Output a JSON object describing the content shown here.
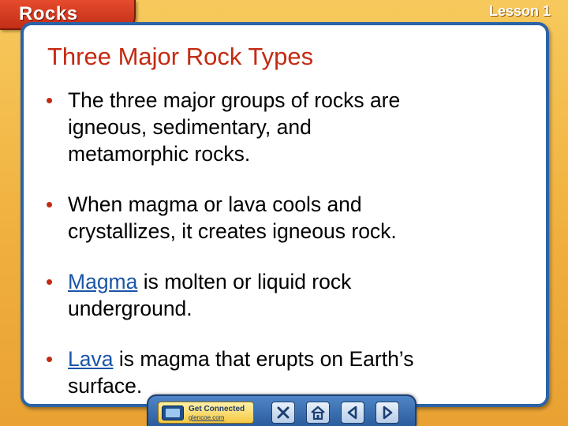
{
  "header": {
    "section_label": "Rocks",
    "lesson_label": "Lesson 1"
  },
  "slide": {
    "title": "Three Major Rock Types",
    "bullets": [
      {
        "line1": "The three major groups of rocks are",
        "line2": "igneous, sedimentary, and",
        "line3": "metamorphic rocks."
      },
      {
        "line1": "When magma or lava cools and",
        "line2": "crystallizes, it creates igneous rock."
      },
      {
        "term": "Magma",
        "line1_rest": " is molten or liquid rock",
        "line2": "underground."
      },
      {
        "term": "Lava",
        "line1_rest": " is magma that erupts on Earth’s",
        "line2": "surface."
      }
    ]
  },
  "nav": {
    "get_connected_label": "Get Connected",
    "get_connected_url": "glencoe.com",
    "icons": {
      "close": "close-icon",
      "home": "home-icon",
      "back": "back-arrow-icon",
      "forward": "forward-arrow-icon"
    }
  },
  "colors": {
    "title": "#c42a12",
    "term_link": "#1a55a8",
    "panel_border": "#2b63a8",
    "background": "#f2b84a",
    "tab": "#d23a20"
  }
}
